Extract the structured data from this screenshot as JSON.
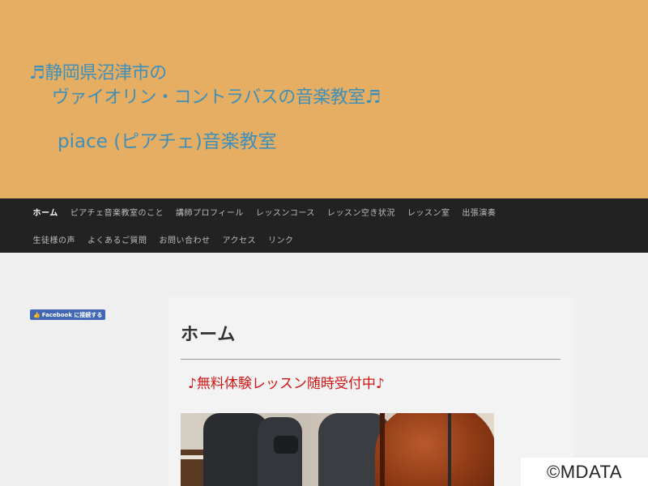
{
  "header": {
    "title_line1": "♬静岡県沼津市の",
    "title_line2": "ヴァイオリン・コントラバスの音楽教室♬",
    "subtitle": "piace (ピアチェ)音楽教室",
    "background_color": "#e6ae63",
    "title_color": "#3f8fb8"
  },
  "nav": {
    "row1": [
      {
        "label": "ホーム",
        "active": true
      },
      {
        "label": "ピアチェ音楽教室のこと"
      },
      {
        "label": "講師プロフィール"
      },
      {
        "label": "レッスンコース"
      },
      {
        "label": "レッスン空き状況"
      },
      {
        "label": "レッスン室"
      },
      {
        "label": "出張演奏"
      }
    ],
    "row2": [
      {
        "label": "生徒様の声"
      },
      {
        "label": "よくあるご質問"
      },
      {
        "label": "お問い合わせ"
      },
      {
        "label": "アクセス"
      },
      {
        "label": "リンク"
      }
    ]
  },
  "sidebar": {
    "facebook_button": "Facebook に接続する",
    "facebook_icon": "thumbs-up-icon"
  },
  "main": {
    "page_title": "ホーム",
    "banner": "♪無料体験レッスン随時受付中♪",
    "banner_color": "#d21414"
  },
  "watermark": "©MDATA"
}
